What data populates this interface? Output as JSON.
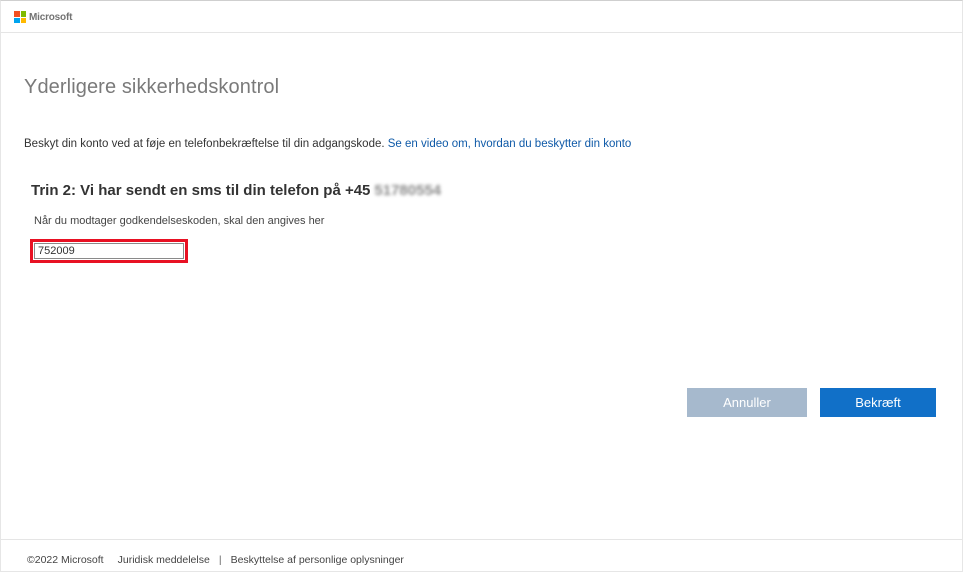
{
  "brand": {
    "name": "Microsoft",
    "colors": {
      "red": "#f25022",
      "green": "#7fba00",
      "blue": "#00a4ef",
      "yellow": "#ffb900"
    }
  },
  "page": {
    "title": "Yderligere sikkerhedskontrol",
    "intro_text": "Beskyt din konto ved at føje en telefonbekræftelse til din adgangskode.",
    "intro_link": "Se en video om, hvordan du beskytter din konto"
  },
  "step": {
    "title": "Trin 2: Vi har sendt en sms til din telefon på +45",
    "phone_masked": "51780554"
  },
  "code_field": {
    "label": "Når du modtager godkendelseskoden, skal den angives her",
    "value": "752009",
    "highlight_color": "#e81123"
  },
  "buttons": {
    "cancel_label": "Annuller",
    "confirm_label": "Bekræft"
  },
  "footer": {
    "copyright": "©2022 Microsoft",
    "legal_link": "Juridisk meddelelse",
    "separator": "|",
    "privacy_link": "Beskyttelse af personlige oplysninger"
  }
}
